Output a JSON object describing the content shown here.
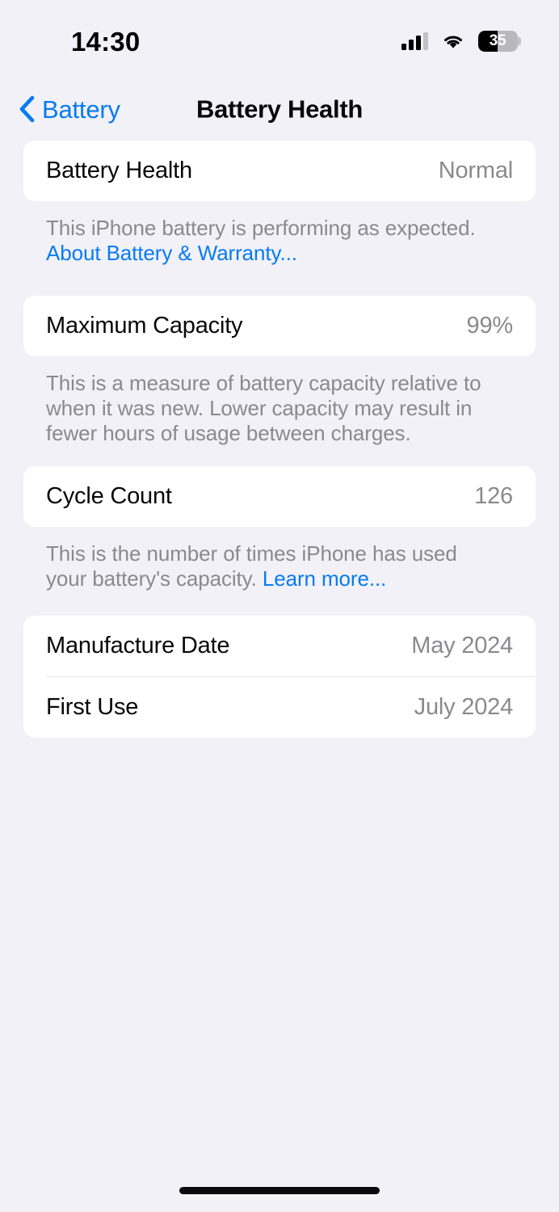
{
  "status_bar": {
    "time": "14:30",
    "cellular_icon": "cellular-signal-icon",
    "cellular_bars_filled": 3,
    "cellular_bars_total": 4,
    "wifi_icon": "wifi-icon",
    "battery_icon": "battery-icon",
    "battery_percent_label": "35",
    "battery_level": 35
  },
  "nav": {
    "back_label": "Battery",
    "back_icon": "chevron-left-icon",
    "title": "Battery Health"
  },
  "sections": [
    {
      "rows": [
        {
          "label": "Battery Health",
          "value": "Normal"
        }
      ],
      "footnote_text": "This iPhone battery is performing as expected. ",
      "footnote_link": "About Battery & Warranty..."
    },
    {
      "rows": [
        {
          "label": "Maximum Capacity",
          "value": "99%"
        }
      ],
      "footnote_text": "This is a measure of battery capacity relative to when it was new. Lower capacity may result in fewer hours of usage between charges.",
      "footnote_link": ""
    },
    {
      "rows": [
        {
          "label": "Cycle Count",
          "value": "126"
        }
      ],
      "footnote_text": "This is the number of times iPhone has used your battery's capacity. ",
      "footnote_link": "Learn more..."
    },
    {
      "rows": [
        {
          "label": "Manufacture Date",
          "value": "May 2024"
        },
        {
          "label": "First Use",
          "value": "July 2024"
        }
      ],
      "footnote_text": "",
      "footnote_link": ""
    }
  ],
  "colors": {
    "page_background": "#f2f1f7",
    "card_background": "#ffffff",
    "accent_blue": "#067bf2",
    "primary_text": "#08080a",
    "secondary_text": "#8a8a8e",
    "divider": "#e6e6e8"
  },
  "home_indicator": "home-indicator"
}
